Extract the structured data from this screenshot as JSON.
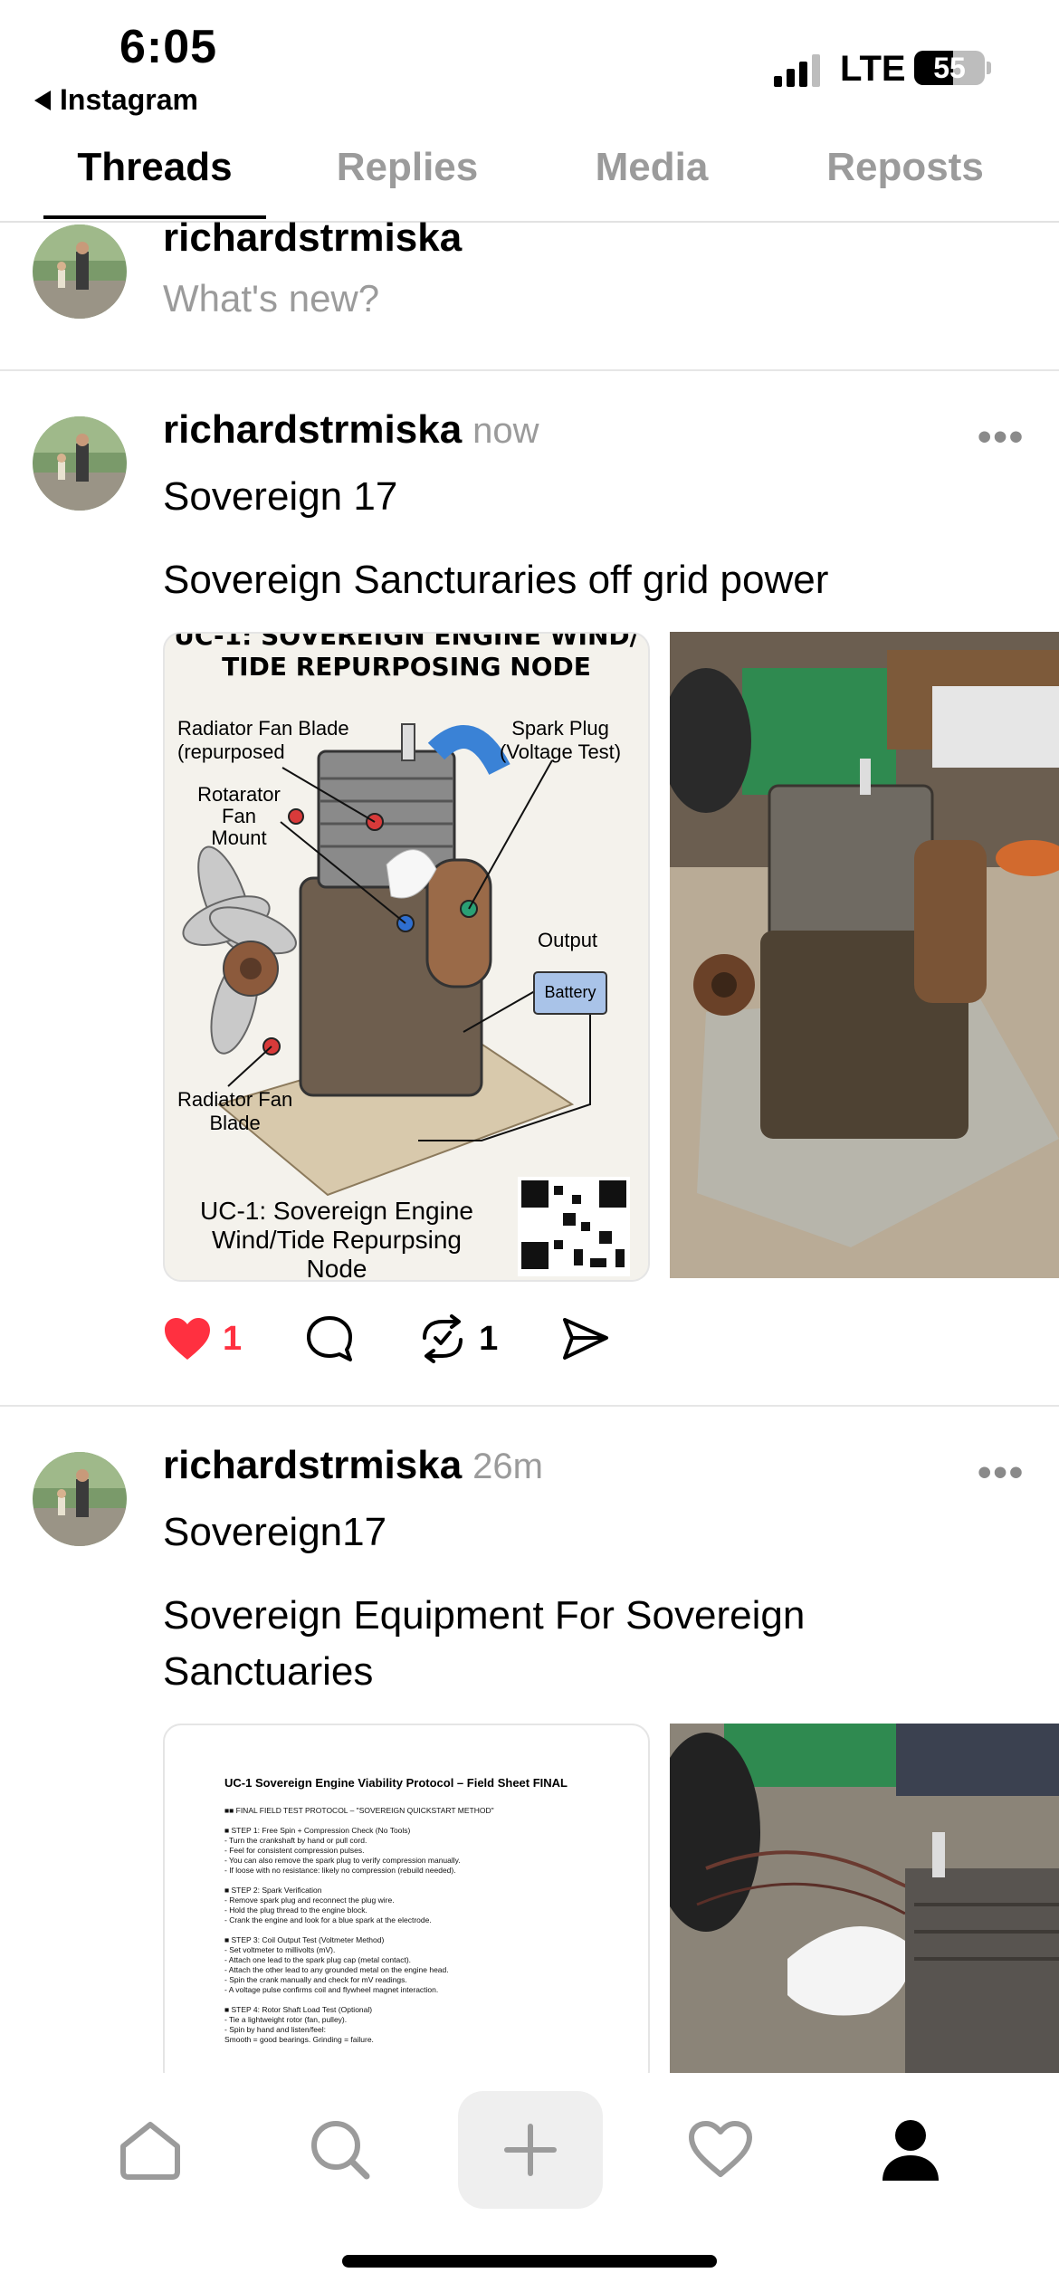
{
  "status_bar": {
    "time": "6:05",
    "back_label": "Instagram",
    "network": "LTE",
    "battery": "55",
    "battery_level": 0.55
  },
  "tabs": [
    {
      "label": "Threads",
      "active": true
    },
    {
      "label": "Replies",
      "active": false
    },
    {
      "label": "Media",
      "active": false
    },
    {
      "label": "Reposts",
      "active": false
    }
  ],
  "composer": {
    "username": "richardstrmiska",
    "placeholder": "What's new?"
  },
  "posts": [
    {
      "username": "richardstrmiska",
      "time": "now",
      "title": "Sovereign 17",
      "body": "Sovereign Sancturaries off grid power",
      "diagram": {
        "header_line1": "UC-1: SOVEREIGN ENGINE WIND/",
        "header_line2": "TIDE REPURPOSING NODE",
        "label_radiator_blade_1": "Radiator Fan Blade",
        "label_radiator_blade_2": "(repurposed",
        "label_spark_1": "Spark Plug",
        "label_spark_2": "(Voltage Test)",
        "label_rotator_1": "Rotarator",
        "label_rotator_2": "Fan",
        "label_rotator_3": "Mount",
        "label_output": "Output",
        "label_battery": "Battery",
        "label_radiator_fan_1": "Radiator Fan",
        "label_radiator_fan_2": "Blade",
        "footer_1": "UC-1: Sovereign Engine",
        "footer_2": "Wind/Tide Repurpsing",
        "footer_3": "Node"
      },
      "likes": "1",
      "reposts": "1"
    },
    {
      "username": "richardstrmiska",
      "time": "26m",
      "title": "Sovereign17",
      "body_line1": "Sovereign Equipment For Sovereign",
      "body_line2": "Sanctuaries",
      "document": {
        "title": "UC-1 Sovereign Engine Viability Protocol – Field Sheet FINAL",
        "lines": [
          "■■ FINAL FIELD TEST PROTOCOL – \"SOVEREIGN QUICKSTART METHOD\"",
          "",
          "■ STEP 1: Free Spin + Compression Check (No Tools)",
          "- Turn the crankshaft by hand or pull cord.",
          "- Feel for consistent compression pulses.",
          "- You can also remove the spark plug to verify compression manually.",
          "- If loose with no resistance: likely no compression (rebuild needed).",
          "",
          "■ STEP 2: Spark Verification",
          "- Remove spark plug and reconnect the plug wire.",
          "- Hold the plug thread to the engine block.",
          "- Crank the engine and look for a blue spark at the electrode.",
          "",
          "■ STEP 3: Coil Output Test (Voltmeter Method)",
          "- Set voltmeter to millivolts (mV).",
          "- Attach one lead to the spark plug cap (metal contact).",
          "- Attach the other lead to any grounded metal on the engine head.",
          "- Spin the crank manually and check for mV readings.",
          "- A voltage pulse confirms coil and flywheel magnet interaction.",
          "",
          "■ STEP 4: Rotor Shaft Load Test (Optional)",
          "- Tie a lightweight rotor (fan, pulley).",
          "- Spin by hand and listen/feel:",
          "  Smooth = good bearings. Grinding = failure."
        ]
      }
    }
  ],
  "bottom_nav": [
    "home-icon",
    "search-icon",
    "plus-icon",
    "heart-icon",
    "profile-icon"
  ],
  "colors": {
    "like_red": "#ff3040",
    "muted": "#9b9b9b",
    "accent_blue": "#3a82d6"
  }
}
